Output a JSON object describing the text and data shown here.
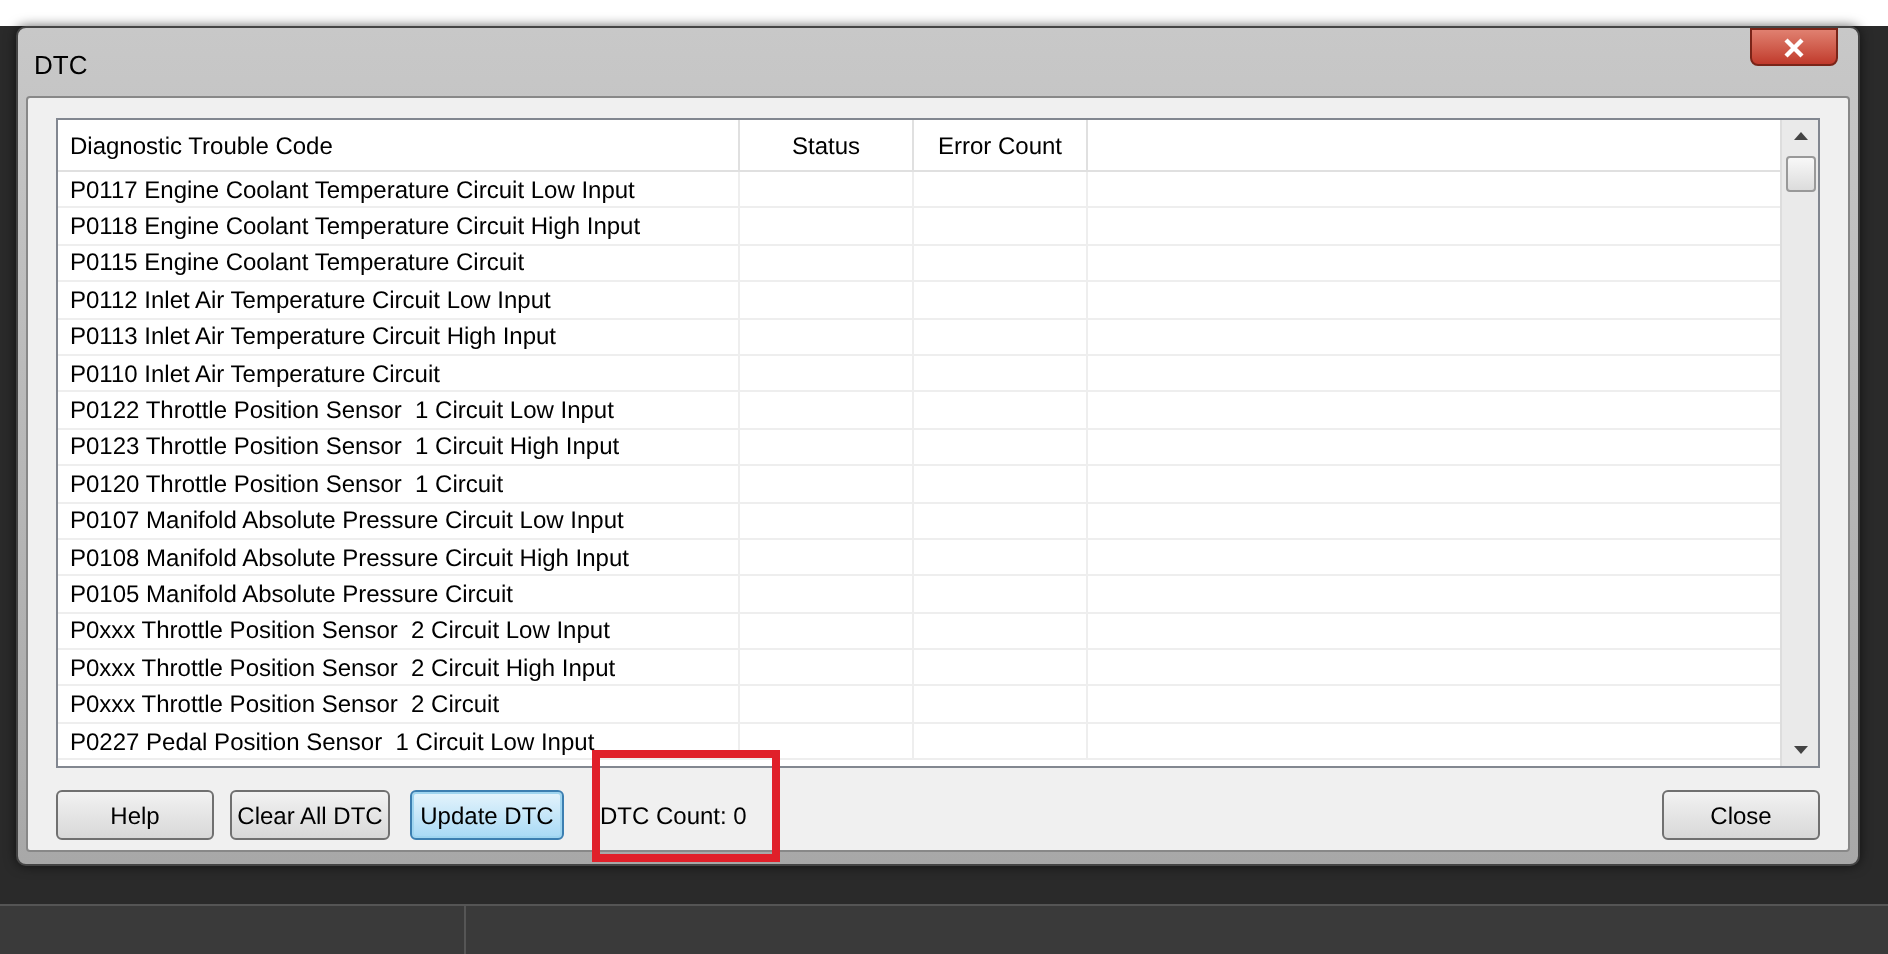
{
  "window": {
    "title": "DTC"
  },
  "table": {
    "columns": [
      "Diagnostic Trouble Code",
      "Status",
      "Error Count"
    ],
    "rows": [
      {
        "code": "P0117 Engine Coolant Temperature Circuit Low Input"
      },
      {
        "code": "P0118 Engine Coolant Temperature Circuit High Input"
      },
      {
        "code": "P0115 Engine Coolant Temperature Circuit"
      },
      {
        "code": "P0112 Inlet Air Temperature Circuit Low Input"
      },
      {
        "code": "P0113 Inlet Air Temperature Circuit High Input"
      },
      {
        "code": "P0110 Inlet Air Temperature Circuit"
      },
      {
        "code": "P0122 Throttle Position Sensor  1 Circuit Low Input"
      },
      {
        "code": "P0123 Throttle Position Sensor  1 Circuit High Input"
      },
      {
        "code": "P0120 Throttle Position Sensor  1 Circuit"
      },
      {
        "code": "P0107 Manifold Absolute Pressure Circuit Low Input"
      },
      {
        "code": "P0108 Manifold Absolute Pressure Circuit High Input"
      },
      {
        "code": "P0105 Manifold Absolute Pressure Circuit"
      },
      {
        "code": "P0xxx Throttle Position Sensor  2 Circuit Low Input"
      },
      {
        "code": "P0xxx Throttle Position Sensor  2 Circuit High Input"
      },
      {
        "code": "P0xxx Throttle Position Sensor  2 Circuit"
      },
      {
        "code": "P0227 Pedal Position Sensor  1 Circuit Low Input"
      }
    ]
  },
  "buttons": [
    {
      "label": "Help",
      "focused": false
    },
    {
      "label": "Clear All DTC",
      "focused": false
    },
    {
      "label": "Update DTC",
      "focused": true
    }
  ],
  "dtc_count": {
    "label": "DTC Count:",
    "value": "0",
    "highlighted": true
  },
  "close_button": {
    "label": "Close"
  }
}
